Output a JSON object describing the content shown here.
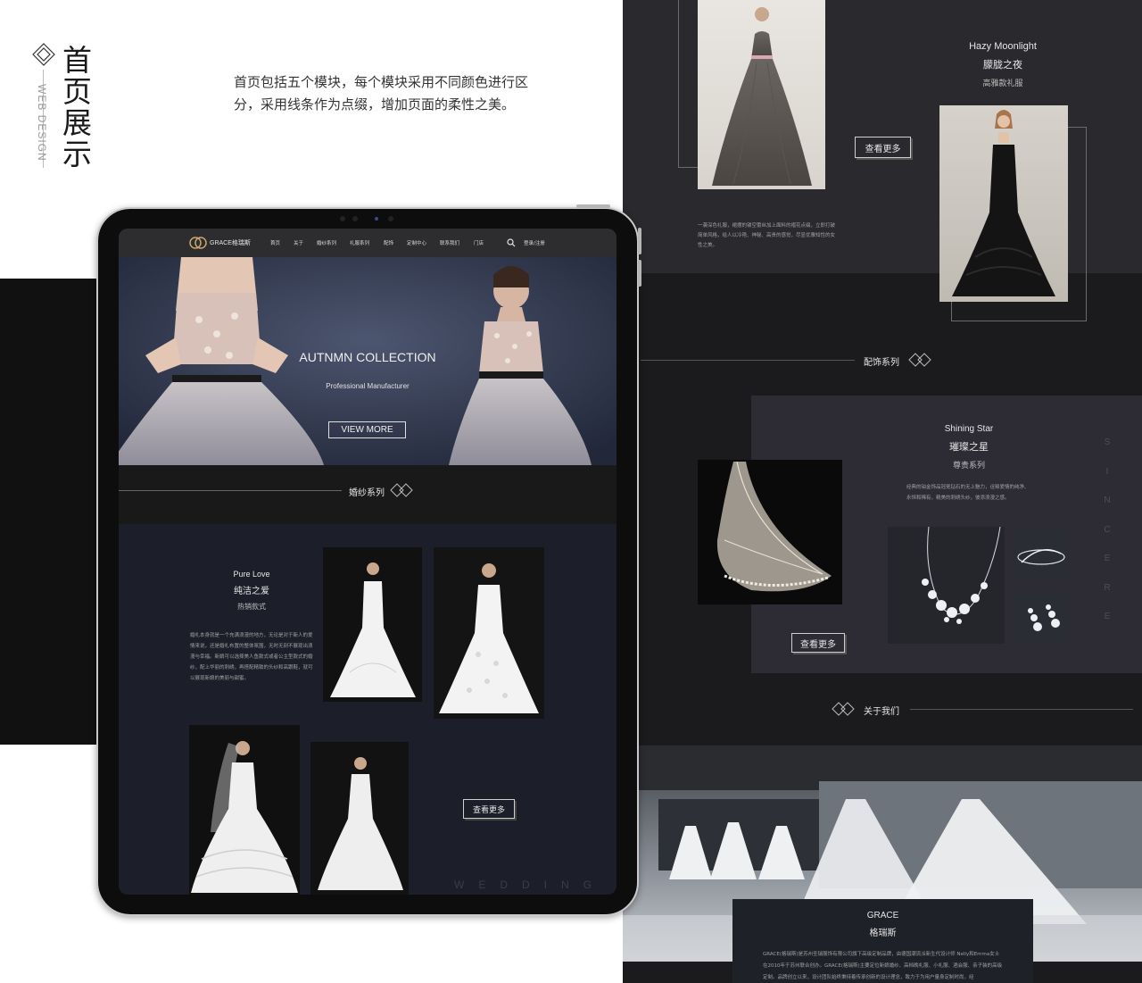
{
  "header": {
    "title_chars": [
      "首",
      "页",
      "展",
      "示"
    ],
    "subtitle": "WEB DESIGN",
    "description": "首页包括五个模块，每个模块采用不同颜色进行区分，采用线条作为点缀，增加页面的柔性之美。"
  },
  "tablet": {
    "nav": {
      "brand": "GRACE格瑞斯",
      "items": [
        "首页",
        "关于",
        "婚纱系列",
        "礼服系列",
        "配饰",
        "定制中心",
        "联系我们",
        "门店"
      ],
      "login": "登录/注册"
    },
    "hero": {
      "title": "AUTNMN COLLECTION",
      "subtitle": "Professional Manufacturer",
      "button": "VIEW MORE",
      "slide_count": 3,
      "active_slide": 2
    },
    "wedding_section": {
      "heading": "婚纱系列",
      "en_title": "Pure Love",
      "cn_title": "纯洁之爱",
      "tag": "热销款式",
      "paragraph": "婚礼本身就是一个充满浪漫的地方，无论是对于新人的爱情来说，还是婚礼布置的整体氛围，无时无刻不展现出浪漫与幸福。新娘可以选择美人鱼款式或者公主型款式的婚纱，配上华丽的刺绣，再搭配精致的头纱和高跟鞋，就可以展现新娘的美丽与甜蜜。",
      "button": "查看更多",
      "watermark": "WEDDING"
    }
  },
  "right_panel": {
    "evening": {
      "en_title": "Hazy Moonlight",
      "cn_title": "朦胧之夜",
      "tag": "高雅款礼服",
      "button": "查看更多",
      "paragraph": "一袭深色礼服，裙摆的镂空蕾丝加上面料的褶花点缀，立即打破简单风格，给人以冷艳、神秘、高贵的感觉，尽显优雅知性的女性之美。"
    },
    "accessories": {
      "heading": "配饰系列",
      "en_title": "Shining Star",
      "cn_title": "璀璨之星",
      "tag": "尊贵系列",
      "paragraph": "经典的铂金饰品冠冕钻石的无上魅力，诠释爱情的纯净、永恒和稀有，精美的刺绣头纱，彼添浪漫之感。",
      "button": "查看更多",
      "vertical_word": [
        "S",
        "I",
        "N",
        "C",
        "E",
        "R",
        "E"
      ]
    },
    "about": {
      "heading": "关于我们",
      "en_title": "GRACE",
      "cn_title": "格瑞斯",
      "paragraph": "GRACE(格瑞斯)是苏州圣瑞服饰有限公司旗下高级定制品牌，由德国潮流派新生代设计师 Nelly和Emma女士在2010年于苏州联合创办。GRACE(格瑞斯)主要定位新娘婚纱、高档晚礼服、小礼服、酒会服、亲子装的高级定制。品牌创立以来，设计团队始终秉持着传承创新的设计理念，致力于为用户量身定制时尚，经"
    }
  },
  "colors": {
    "panel_dark": "#1b1b1d",
    "panel_mid": "#2a2a2e",
    "screen_navy": "#1c1f2a",
    "accent_gold": "#c9a86a"
  }
}
